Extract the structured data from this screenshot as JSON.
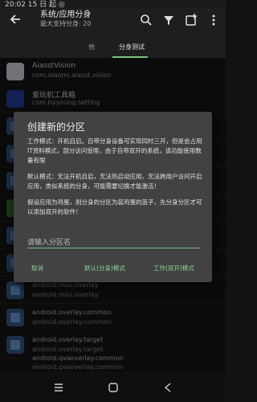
{
  "status_bar": {
    "time": "20:02 15 日 起 ◎"
  },
  "toolbar": {
    "title": "系统/应用分身",
    "subtitle": "最大支持分身: 20"
  },
  "tabs": [
    {
      "label": "他"
    },
    {
      "label": "分身测试"
    }
  ],
  "apps": [
    {
      "name": "AiasstVision",
      "pkg": "com.xiaomi.aiasst.vision"
    },
    {
      "name": "爱玩机工具箱",
      "pkg": "com.byyoung.setting"
    },
    {
      "name": "",
      "pkg": "android.miui.overlay"
    },
    {
      "name": "",
      "pkg": "android.miui.overlay"
    },
    {
      "name": "",
      "pkg": "android.overlay.common"
    },
    {
      "name": "",
      "pkg": "android.overlay.common"
    },
    {
      "name": "",
      "pkg": "android.overlay.target"
    },
    {
      "name": "",
      "pkg": "android.overlay.target"
    },
    {
      "name": "",
      "pkg": "android.qvaoverlay.common"
    },
    {
      "name": "",
      "pkg": "android.qvaoverlay.common"
    }
  ],
  "dialog": {
    "title": "创建新的分区",
    "paragraph1": "工作模式：开机自启。自带分身设备可实现同时三开，但是会占用IT资料模式，部分访问受限，由于自带双开的系统，该功能使用数量有限",
    "paragraph2": "默认模式：无法开机自启，无法热启动应用，无法跨用户访问开启应用，类似系统的分身，可能需要切换才能激活！",
    "paragraph3": "假设应用为鸡蛋，则分身的分区为装鸡蛋的篮子，先分身分区才可以添加双开的软件！",
    "input_placeholder": "请输入分区名",
    "cancel_label": "取消",
    "default_label": "默认(分身)模式",
    "work_label": "工作(双开)模式"
  },
  "colors": {
    "accent": "#7cc47f",
    "dialog_bg": "#424242"
  }
}
